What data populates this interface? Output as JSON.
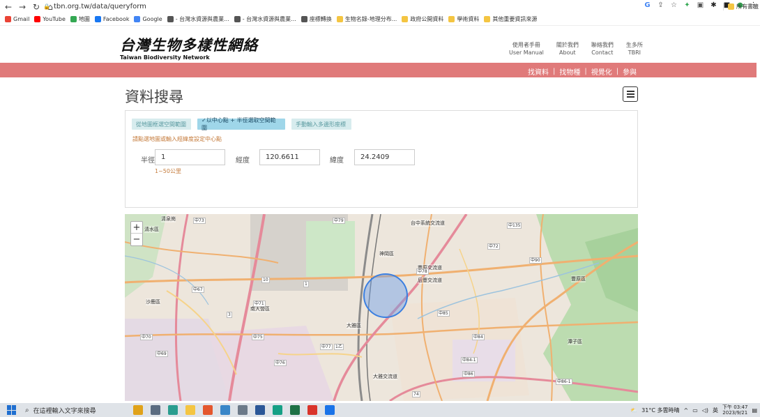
{
  "browser": {
    "url": "tbn.org.tw/data/queryform",
    "bookmarks": [
      {
        "label": "Gmail",
        "color": "#ea4335"
      },
      {
        "label": "YouTube",
        "color": "#ff0000"
      },
      {
        "label": "地圖",
        "color": "#34a853"
      },
      {
        "label": "Facebook",
        "color": "#1877f2"
      },
      {
        "label": "Google",
        "color": "#4285f4"
      },
      {
        "label": "- 台灣水資源與農業...",
        "color": "#555555"
      },
      {
        "label": "- 台灣水資源與農業...",
        "color": "#555555"
      },
      {
        "label": "座標轉換",
        "color": "#555555"
      },
      {
        "label": "生物名錄-地理分布...",
        "color": "#f4c542"
      },
      {
        "label": "政府公開資料",
        "color": "#f4c542"
      },
      {
        "label": "學術資料",
        "color": "#f4c542"
      },
      {
        "label": "其他重要資訊來源",
        "color": "#f4c542"
      }
    ],
    "bookmarks_right": "所有書籤"
  },
  "site": {
    "logo_cn": "台灣生物多樣性網絡",
    "logo_en": "Taiwan Biodiversity Network",
    "top_links": [
      {
        "cn": "使用者手冊",
        "en": "User Manual"
      },
      {
        "cn": "關於我們",
        "en": "About"
      },
      {
        "cn": "聯絡我們",
        "en": "Contact"
      },
      {
        "cn": "生多所",
        "en": "TBRI"
      }
    ],
    "nav": [
      "找資料",
      "找物種",
      "視覺化",
      "參與"
    ],
    "accent": "#e07a7a"
  },
  "page": {
    "title": "資料搜尋",
    "modes": [
      "從地圖框選空間範圍",
      "✓以中心點 + 半徑選取空間範圍",
      "手動輸入多邊形座標"
    ],
    "hint": "請點選地圖或輸入經緯度設定中心點",
    "radius_label": "半徑",
    "radius_value": "1",
    "radius_range": "1~50公里",
    "lon_label": "經度",
    "lon_value": "120.6611",
    "lat_label": "緯度",
    "lat_value": "24.2409"
  },
  "map": {
    "labels": [
      "清水區",
      "神岡區",
      "潭子區",
      "豐原區",
      "大雅區",
      "沙鹿區",
      "南大營區",
      "大雅交流道",
      "清泉崗",
      "台中系統交流道",
      "豐原交流道",
      "后豐交流道"
    ],
    "roads": [
      "中73",
      "中79",
      "中78",
      "中72",
      "中135",
      "中90",
      "中67",
      "中71",
      "中75",
      "中77",
      "中76",
      "中85",
      "中84",
      "中84-1",
      "中86",
      "中86-1",
      "中70",
      "中69",
      "10",
      "3",
      "1",
      "1乙",
      "74"
    ],
    "circle_color": "#3b7fe0"
  },
  "taskbar": {
    "search_placeholder": "在這裡輸入文字來搜尋",
    "weather": "31°C 多雲時晴",
    "ime": "英",
    "time": "下午 03:47",
    "date": "2023/9/21"
  }
}
